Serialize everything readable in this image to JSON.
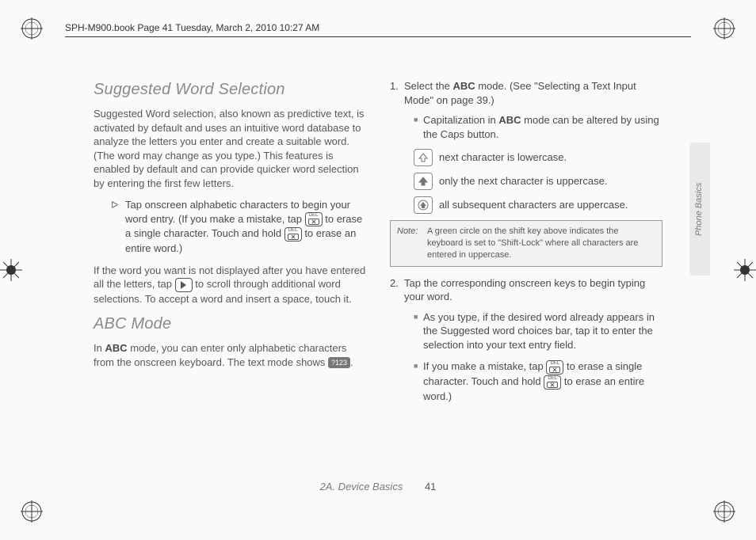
{
  "meta": {
    "header": "SPH-M900.book  Page 41  Tuesday, March 2, 2010  10:27 AM"
  },
  "side_tab": "Phone Basics",
  "col1": {
    "h1": "Suggested Word Selection",
    "p1": "Suggested Word selection, also known as predictive text, is activated by default and uses an intuitive word database to analyze the letters you enter and create a suitable word. (The word may change as you type.) This features is enabled by default and can provide quicker word selection by entering the first few letters.",
    "b1a": "Tap onscreen alphabetic characters to begin your word entry. (If you make a mistake, tap ",
    "b1b": " to erase a single character. Touch and hold ",
    "b1c": " to erase an entire word.)",
    "p2a": "If the word you want is not displayed after you have entered all the letters, tap ",
    "p2b": " to scroll through additional word selections. To accept a word and insert a space, touch it.",
    "h2": "ABC Mode",
    "p3a": "In ",
    "p3bold": "ABC",
    "p3b": " mode, you can enter only alphabetic characters from the onscreen keyboard. The text mode shows ",
    "p3c": ".",
    "mode_icon": "?123"
  },
  "col2": {
    "s1num": "1.",
    "s1a": "Select the ",
    "s1bold": "ABC",
    "s1b": " mode. (See \"Selecting a Text Input Mode\" on page 39.)",
    "s1ba_a": "Capitalization in ",
    "s1ba_bold": "ABC",
    "s1ba_b": " mode can be altered by using the Caps button.",
    "shift1": "next character is lowercase.",
    "shift2": "only the next character is uppercase.",
    "shift3": "all subsequent characters are uppercase.",
    "note_label": "Note:",
    "note_text": "A green circle on the shift key above indicates the keyboard is set to \"Shift-Lock\" where all characters are entered in uppercase.",
    "s2num": "2.",
    "s2": "Tap the corresponding onscreen keys to begin typing your word.",
    "s2ba": "As you type, if the desired word already appears in the Suggested word choices bar, tap it to enter the selection into your text entry field.",
    "s2bb_a": "If you make a mistake, tap ",
    "s2bb_b": " to erase a single character. Touch and hold ",
    "s2bb_c": " to erase an entire word.)"
  },
  "footer": {
    "section": "2A. Device Basics",
    "page": "41"
  }
}
